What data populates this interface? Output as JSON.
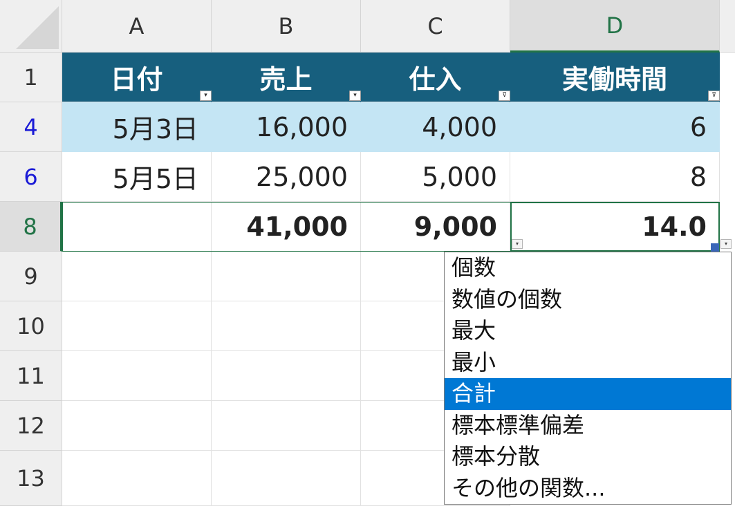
{
  "columns": [
    "A",
    "B",
    "C",
    "D"
  ],
  "rows": [
    "1",
    "4",
    "6",
    "8",
    "9",
    "10",
    "11",
    "12",
    "13"
  ],
  "header": {
    "date": "日付",
    "sales": "売上",
    "purchase": "仕入",
    "hours": "実働時間"
  },
  "data_rows": [
    {
      "date": "5月3日",
      "sales": "16,000",
      "purchase": "4,000",
      "hours": "6"
    },
    {
      "date": "5月5日",
      "sales": "25,000",
      "purchase": "5,000",
      "hours": "8"
    }
  ],
  "total_row": {
    "sales": "41,000",
    "purchase": "9,000",
    "hours": "14.0"
  },
  "dropdown": {
    "items": [
      "個数",
      "数値の個数",
      "最大",
      "最小",
      "合計",
      "標本標準偏差",
      "標本分散",
      "その他の関数..."
    ],
    "selected": "合計"
  },
  "colors": {
    "header_bg": "#175f7e",
    "band_bg": "#c4e5f4",
    "accent": "#217346",
    "menu_highlight": "#0078d4"
  }
}
